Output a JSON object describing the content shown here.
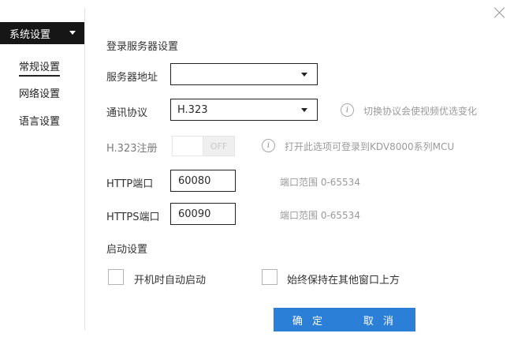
{
  "sidebar": {
    "menu_title": "系统设置",
    "items": [
      {
        "label": "常规设置",
        "active": true
      },
      {
        "label": "网络设置",
        "active": false
      },
      {
        "label": "语言设置",
        "active": false
      }
    ]
  },
  "login": {
    "section_title": "登录服务器设置",
    "server_address_label": "服务器地址",
    "server_address_value": "",
    "protocol_label": "通讯协议",
    "protocol_value": "H.323",
    "protocol_hint": "切换协议会使视频优选变化",
    "h323_label": "H.323注册",
    "h323_toggle_state": "OFF",
    "h323_hint": "打开此选项可登录到KDV8000系列MCU",
    "http_port_label": "HTTP端口",
    "http_port_value": "60080",
    "http_port_range": "端口范围 0-65534",
    "https_port_label": "HTTPS端口",
    "https_port_value": "60090",
    "https_port_range": "端口范围 0-65534"
  },
  "startup": {
    "section_title": "启动设置",
    "autostart_label": "开机时自动启动",
    "autostart_checked": false,
    "always_on_top_label": "始终保持在其他窗口上方",
    "always_on_top_checked": false
  },
  "buttons": {
    "ok": "确 定",
    "cancel": "取 消"
  },
  "colors": {
    "accent": "#2b7fd6",
    "menu_header": "#161616"
  }
}
